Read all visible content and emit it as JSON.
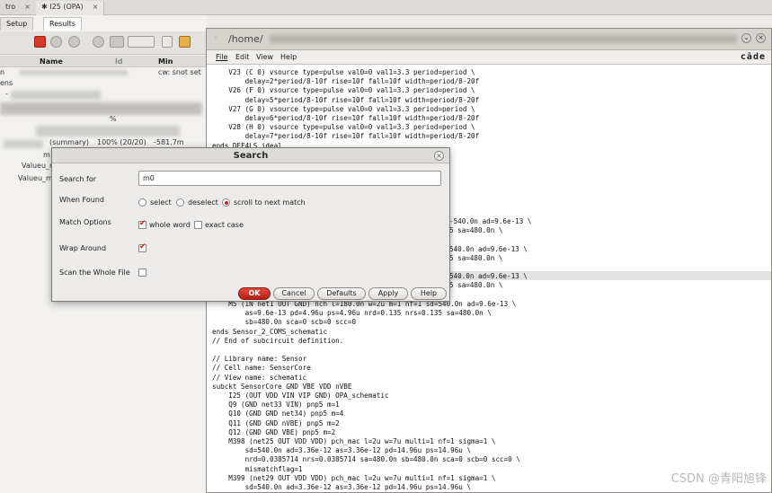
{
  "tabs": [
    {
      "label": "tro"
    },
    {
      "label": "I25 (OPA)"
    }
  ],
  "left": {
    "subtabs": [
      "Setup",
      "Results"
    ],
    "columns": [
      "Name",
      "Min"
    ],
    "rows": [
      {
        "a": "n",
        "b": "",
        "c": "cw: snot set"
      },
      {
        "a": "ens",
        "b": "",
        "c": ""
      },
      {
        "a": "-",
        "b": "",
        "c": ""
      },
      {
        "a": "%",
        "b": "",
        "c": ""
      },
      {
        "a": "(summary)",
        "b": "100% (20/20)",
        "c": "-581.7m"
      },
      {
        "a": "m",
        "b": "",
        "c": ""
      },
      {
        "a": "Valueu_m",
        "b": "",
        "c": ""
      },
      {
        "a": "Valueu_m",
        "b": "",
        "c": ""
      }
    ]
  },
  "terminal": {
    "path": "/home/",
    "menu": [
      "File",
      "Edit",
      "View",
      "Help"
    ],
    "brand": "cāde",
    "lines_top": [
      "    V23 (C 0) vsource type=pulse val0=0 val1=3.3 period=period \\",
      "        delay=2*period/8-10f rise=10f fall=10f width=period/8-20f",
      "    V26 (F 0) vsource type=pulse val0=0 val1=3.3 period=period \\",
      "        delay=5*period/8-10f rise=10f fall=10f width=period/8-20f",
      "    V27 (G 0) vsource type=pulse val0=0 val1=3.3 period=period \\",
      "        delay=6*period/8-10f rise=10f fall=10f width=period/8-20f",
      "    V28 (H 0) vsource type=pulse val0=0 val1=3.3 period=period \\",
      "        delay=7*period/8-10f rise=10f fall=10f width=period/8-20f",
      "ends DFF4LS_ideal"
    ],
    "lines_right": [
      "-540.0n ad=9.6e-13 \\",
      "5 sa=480.0n \\",
      "",
      "540.0n ad=9.6e-13 \\",
      "5 sa=480.0n \\",
      "",
      "540.0n ad=9.6e-13 \\",
      "5 sa=480.0n \\"
    ],
    "lines_bottom": [
      "    M5 (IN net1 OUT GND) nch l=180.0n w=2u m=1 nf=1 sd=540.0n ad=9.6e-13 \\",
      "        as=9.6e-13 pd=4.96u ps=4.96u nrd=0.135 nrs=0.135 sa=480.0n \\",
      "        sb=480.0n sca=0 scb=0 scc=0",
      "ends Sensor_2_COMS_schematic",
      "// End of subcircuit definition.",
      "",
      "// Library name: Sensor",
      "// Cell name: SensorCore",
      "// View name: schematic",
      "subckt SensorCore GND VBE VDD nVBE",
      "    I25 (OUT VDD VIN VIP GND) OPA_schematic",
      "    Q9 (GND net33 VIN) pnp5 m=1",
      "    Q10 (GND GND net34) pnp5 m=4",
      "    Q11 (GND GND nVBE) pnp5 m=2",
      "    Q12 (GND GND VBE) pnp5 m=2",
      "    M398 (net25 OUT VDD VDD) pch_mac l=2u w=7u multi=1 nf=1 sigma=1 \\",
      "        sd=540.0n ad=3.36e-12 as=3.36e-12 pd=14.96u ps=14.96u \\",
      "        nrd=0.0385714 nrs=0.0385714 sa=480.0n sb=480.0n sca=0 scb=0 scc=0 \\",
      "        mismatchflag=1",
      "    M399 (net29 OUT VDD VDD) pch_mac l=2u w=7u multi=1 nf=1 sigma=1 \\",
      "        sd=540.0n ad=3.36e-12 as=3.36e-12 pd=14.96u ps=14.96u \\"
    ]
  },
  "search": {
    "title": "Search",
    "search_for_label": "Search for",
    "search_value": "m0",
    "when_found_label": "When Found",
    "when_found_options": [
      "select",
      "deselect",
      "scroll to next match"
    ],
    "when_found_selected": "scroll to next match",
    "match_options_label": "Match Options",
    "whole_word_label": "whole word",
    "whole_word_checked": true,
    "exact_case_label": "exact case",
    "exact_case_checked": false,
    "wrap_around_label": "Wrap Around",
    "wrap_around_checked": true,
    "scan_whole_label": "Scan the Whole File",
    "scan_whole_checked": false,
    "buttons": {
      "ok": "OK",
      "cancel": "Cancel",
      "defaults": "Defaults",
      "apply": "Apply",
      "help": "Help"
    }
  },
  "watermark": "CSDN @青阳旭锋",
  "colors": {
    "accent": "#c0271d",
    "ok_button": "#c92a1e",
    "title_bar": "#d6d3cf"
  }
}
